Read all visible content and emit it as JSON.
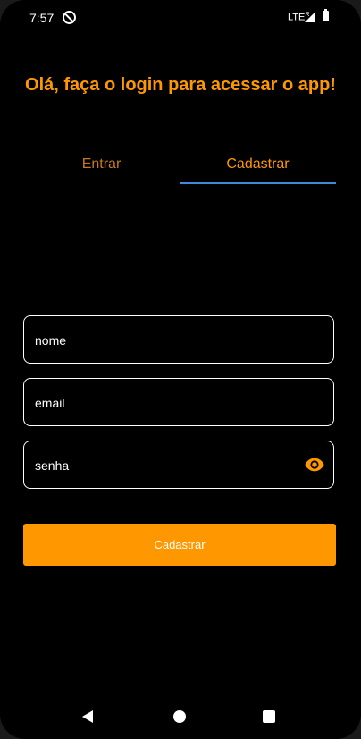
{
  "status_bar": {
    "time": "7:57",
    "network": "LTE",
    "network_sup": "R",
    "icons": [
      "app-notification-icon",
      "signal-icon",
      "battery-icon"
    ]
  },
  "title": "Olá, faça o login para acessar o app!",
  "tabs": [
    {
      "label": "Entrar",
      "selected": false
    },
    {
      "label": "Cadastrar",
      "selected": true
    }
  ],
  "form": {
    "name_placeholder": "nome",
    "email_placeholder": "email",
    "password_placeholder": "senha",
    "password_toggle_icon": "eye-icon",
    "submit_label": "Cadastrar"
  },
  "colors": {
    "accent": "#FF9800",
    "tab_inactive": "#C77A1A",
    "tab_indicator": "#3D8BD9",
    "background": "#000000"
  },
  "navigation": {
    "icons": [
      "back-icon",
      "home-icon",
      "recents-icon"
    ]
  }
}
